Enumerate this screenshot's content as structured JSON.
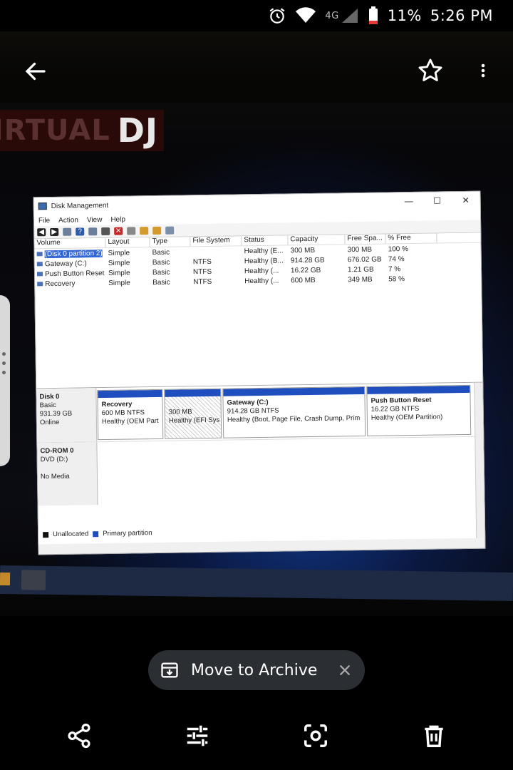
{
  "status_bar": {
    "network": "4G",
    "battery": "11%",
    "time": "5:26 PM"
  },
  "app_bar": {
    "back_icon": "arrow-left-icon",
    "favorite_icon": "star-outline-icon",
    "more_icon": "more-vertical-icon"
  },
  "photo": {
    "background_logo": "DJ",
    "background_logo_fragment": "IRTUAL",
    "window": {
      "title": "Disk Management",
      "controls": [
        "—",
        "☐",
        "✕"
      ],
      "menu": [
        "File",
        "Action",
        "View",
        "Help"
      ],
      "columns": [
        "Volume",
        "Layout",
        "Type",
        "File System",
        "Status",
        "Capacity",
        "Free Spa...",
        "% Free"
      ],
      "rows": [
        {
          "volume": "(Disk 0 partition 2)",
          "layout": "Simple",
          "type": "Basic",
          "fs": "",
          "status": "Healthy (E...",
          "capacity": "300 MB",
          "free": "300 MB",
          "pct": "100 %"
        },
        {
          "volume": "Gateway (C:)",
          "layout": "Simple",
          "type": "Basic",
          "fs": "NTFS",
          "status": "Healthy (B...",
          "capacity": "914.28 GB",
          "free": "676.02 GB",
          "pct": "74 %"
        },
        {
          "volume": "Push Button Reset",
          "layout": "Simple",
          "type": "Basic",
          "fs": "NTFS",
          "status": "Healthy (...",
          "capacity": "16.22 GB",
          "free": "1.21 GB",
          "pct": "7 %"
        },
        {
          "volume": "Recovery",
          "layout": "Simple",
          "type": "Basic",
          "fs": "NTFS",
          "status": "Healthy (...",
          "capacity": "600 MB",
          "free": "349 MB",
          "pct": "58 %"
        }
      ],
      "disk0": {
        "name": "Disk 0",
        "kind": "Basic",
        "size": "931.39 GB",
        "state": "Online",
        "partitions": [
          {
            "name": "Recovery",
            "size": "600 MB NTFS",
            "status": "Healthy (OEM Part"
          },
          {
            "name": "",
            "size": "300 MB",
            "status": "Healthy (EFI Sys"
          },
          {
            "name": "Gateway  (C:)",
            "size": "914.28 GB NTFS",
            "status": "Healthy (Boot, Page File, Crash Dump, Prim"
          },
          {
            "name": "Push Button Reset",
            "size": "16.22 GB NTFS",
            "status": "Healthy (OEM Partition)"
          }
        ]
      },
      "cdrom": {
        "name": "CD-ROM 0",
        "drive": "DVD (D:)",
        "state": "No Media"
      },
      "legend": [
        "Unallocated",
        "Primary partition"
      ]
    }
  },
  "snackbar": {
    "icon": "archive-icon",
    "label": "Move to Archive",
    "close_icon": "close-icon"
  },
  "bottom_bar": {
    "items": [
      "share-icon",
      "edit-sliders-icon",
      "lens-icon",
      "trash-icon"
    ]
  }
}
